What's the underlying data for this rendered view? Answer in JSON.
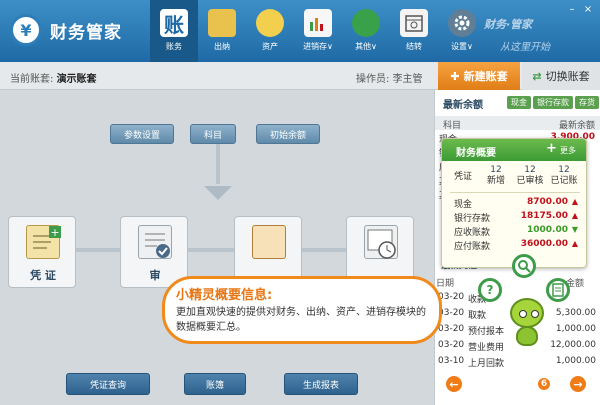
{
  "app": {
    "title": "财务管家",
    "logo_symbol": "¥",
    "brand_line1": "财务·管家",
    "brand_line2": "从这里开始"
  },
  "nav": [
    {
      "label": "账务",
      "glyph": "账",
      "icon": "ledger-icon",
      "active": true
    },
    {
      "label": "出纳",
      "glyph": "",
      "icon": "cashier-icon",
      "active": false
    },
    {
      "label": "资产",
      "glyph": "",
      "icon": "assets-icon",
      "active": false
    },
    {
      "label": "进销存∨",
      "glyph": "",
      "icon": "inventory-chart-icon",
      "active": false
    },
    {
      "label": "其他∨",
      "glyph": "",
      "icon": "other-icon",
      "active": false
    },
    {
      "label": "结转",
      "glyph": "",
      "icon": "calendar-icon",
      "active": false
    },
    {
      "label": "设置∨",
      "glyph": "",
      "icon": "gear-icon",
      "active": false
    }
  ],
  "window_controls": {
    "minimize": "–",
    "close": "×"
  },
  "subbar": {
    "account_prefix": "当前账套:",
    "account_name": "演示账套",
    "operator": "操作员: 李主管",
    "new_account": "新建账套",
    "switch_account": "切换账套"
  },
  "workflow": {
    "top_buttons": [
      "参数设置",
      "科目",
      "初始余额"
    ],
    "cards": [
      {
        "label": "凭 证",
        "icon": "voucher-icon"
      },
      {
        "label": "审",
        "icon": "review-icon"
      },
      {
        "label": "",
        "icon": "clipboard-icon"
      },
      {
        "label": "",
        "icon": "calendar-clock-icon"
      }
    ],
    "bottom_buttons": [
      "凭证查询",
      "账簿",
      "生成报表"
    ]
  },
  "tip": {
    "title": "小精灵概要信息:",
    "text": "更加直观快速的提供对财务、出纳、资产、进销存模块的数据概要汇总。"
  },
  "right_panel": {
    "title": "最新余额",
    "tabs": [
      "现金",
      "银行存款",
      "存货"
    ],
    "col_subject": "科目",
    "col_balance": "最新余额",
    "rows": [
      {
        "name": "现金",
        "value": "3,900.00"
      },
      {
        "name": "银",
        "value": ""
      },
      {
        "name": "应",
        "value": ""
      },
      {
        "name": "其",
        "value": ""
      },
      {
        "name": "其",
        "value": ""
      }
    ],
    "section2_title": "最新凭证",
    "list_head": {
      "date": "日期",
      "amount": "金额"
    },
    "list": [
      {
        "date": "03-20",
        "text": "收款",
        "amount": ""
      },
      {
        "date": "03-20",
        "text": "取款",
        "amount": "5,300.00"
      },
      {
        "date": "03-20",
        "text": "预付报本",
        "amount": "1,000.00"
      },
      {
        "date": "03-20",
        "text": "营业费用",
        "amount": "12,000.00"
      },
      {
        "date": "03-10",
        "text": "上月回款",
        "amount": "1,000.00"
      }
    ]
  },
  "overview": {
    "title": "财务概要",
    "add": "+",
    "more": "更多",
    "voucher_label": "凭证",
    "stats": [
      {
        "num": "12",
        "label": "新增"
      },
      {
        "num": "12",
        "label": "已审核"
      },
      {
        "num": "12",
        "label": "已记账"
      }
    ],
    "rows": [
      {
        "name": "现金",
        "value": "8700.00",
        "arrow": "▲",
        "color": "#c0121c"
      },
      {
        "name": "银行存款",
        "value": "18175.00",
        "arrow": "▲",
        "color": "#c0121c"
      },
      {
        "name": "应收账款",
        "value": "1000.00",
        "arrow": "▼",
        "color": "#3a9a2a"
      },
      {
        "name": "应付账款",
        "value": "36000.00",
        "arrow": "▲",
        "color": "#c0121c"
      }
    ]
  },
  "carousel": {
    "prev": "←",
    "next": "→",
    "active_page": "6",
    "total_dots": 7
  },
  "colors": {
    "header": "#1f6aa6",
    "accent_orange": "#f07c18",
    "green": "#3d9b4a"
  }
}
